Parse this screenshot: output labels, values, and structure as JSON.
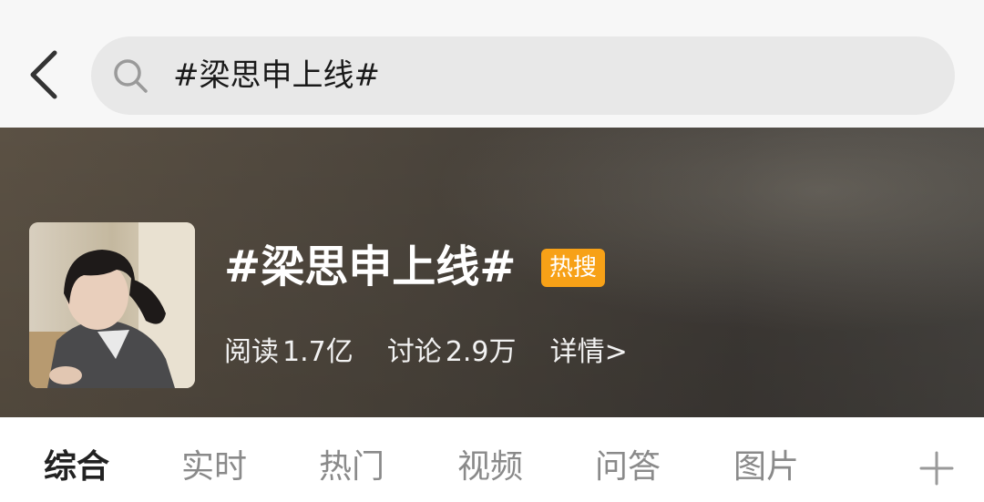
{
  "search": {
    "query": "#梁思申上线#"
  },
  "topic": {
    "title": "#梁思申上线#",
    "badge": "热搜",
    "read_label": "阅读",
    "read_value": "1.7亿",
    "discuss_label": "讨论",
    "discuss_value": "2.9万",
    "detail_link": "详情>"
  },
  "tabs": [
    {
      "label": "综合",
      "active": true
    },
    {
      "label": "实时",
      "active": false
    },
    {
      "label": "热门",
      "active": false
    },
    {
      "label": "视频",
      "active": false
    },
    {
      "label": "问答",
      "active": false
    },
    {
      "label": "图片",
      "active": false
    }
  ],
  "colors": {
    "badge": "#f7a117",
    "search_bg": "#e8e8e8",
    "active_tab": "#222222",
    "inactive_tab": "#8a8a8a"
  },
  "icons": {
    "back": "chevron-left-icon",
    "search": "search-icon",
    "add_tab": "plus-icon"
  }
}
